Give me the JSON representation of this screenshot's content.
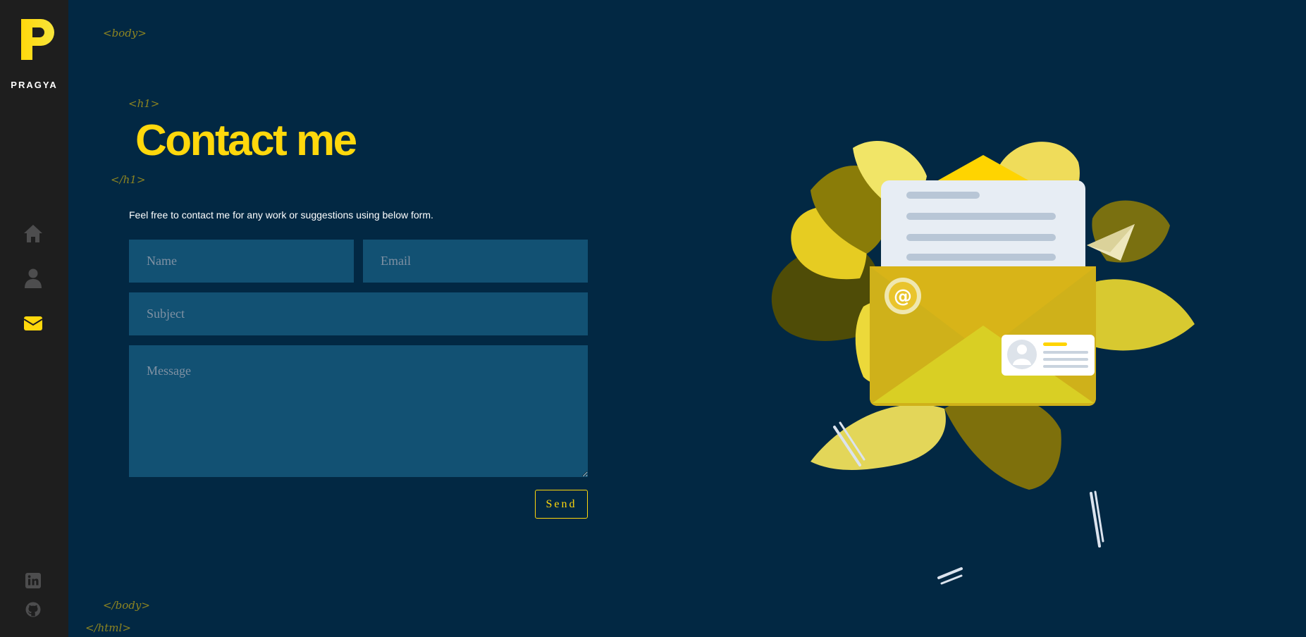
{
  "sidebar": {
    "logo_letter": "P",
    "logo_name": "PRAGYA",
    "nav": [
      {
        "icon": "home-icon",
        "active": false
      },
      {
        "icon": "user-icon",
        "active": false
      },
      {
        "icon": "envelope-icon",
        "active": true
      }
    ],
    "social": [
      {
        "icon": "linkedin-icon"
      },
      {
        "icon": "github-icon"
      }
    ]
  },
  "tags": {
    "body_open": "<body>",
    "h1_open": "<h1>",
    "h1_close": "</h1>",
    "body_close": "</body>",
    "html_close": "</html>"
  },
  "page": {
    "title": "Contact me",
    "intro": "Feel free to contact me for any work or suggestions using below form."
  },
  "form": {
    "name_placeholder": "Name",
    "email_placeholder": "Email",
    "subject_placeholder": "Subject",
    "message_placeholder": "Message",
    "send_label": "Send"
  },
  "colors": {
    "accent": "#ffd80c",
    "background": "#022843",
    "sidebar": "#1e1e1e",
    "input": "#125173",
    "tag": "#8e8521"
  }
}
